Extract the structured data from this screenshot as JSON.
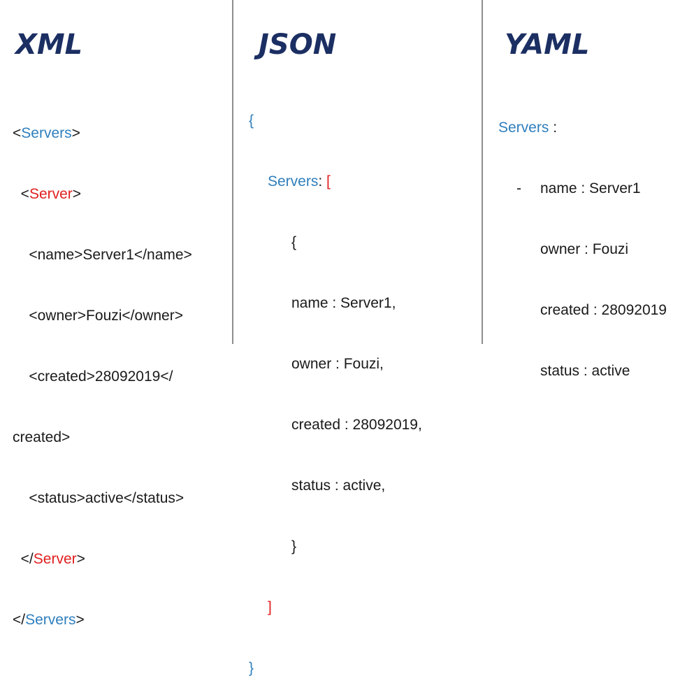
{
  "columns": {
    "xml": {
      "title": "XML",
      "lines": [
        [
          "<",
          "Servers",
          ">"
        ],
        [
          "  <",
          "Server",
          ">"
        ],
        [
          "    <name>Server1</name>"
        ],
        [
          "    <owner>Fouzi</owner>"
        ],
        [
          "    <created>28092019</"
        ],
        [
          "created>"
        ],
        [
          "    <status>active</status>"
        ],
        [
          "  </",
          "Server",
          ">"
        ],
        [
          "</",
          "Servers",
          ">"
        ]
      ]
    },
    "json": {
      "title": "JSON",
      "open_brace": "{",
      "servers_key": "Servers",
      "colon": ": ",
      "open_bracket": "[",
      "item_open": "{",
      "name_line": "name : Server1,",
      "owner_line": "owner : Fouzi,",
      "created_line": "created : 28092019,",
      "status_line": "status : active,",
      "item_close": "}",
      "close_bracket": "]",
      "close_brace": "}"
    },
    "yaml": {
      "title": "YAML",
      "servers_key": "Servers",
      "colon": " :",
      "dash": "-",
      "name_line": "name : Server1",
      "owner_line": "owner : Fouzi",
      "created_line": "created : 28092019",
      "status_line": "status : active"
    }
  },
  "colors": {
    "title": "#1c2f63",
    "tag_blue": "#2f7fbd",
    "tag_red": "#e02020",
    "divider": "#8e8e8e"
  }
}
